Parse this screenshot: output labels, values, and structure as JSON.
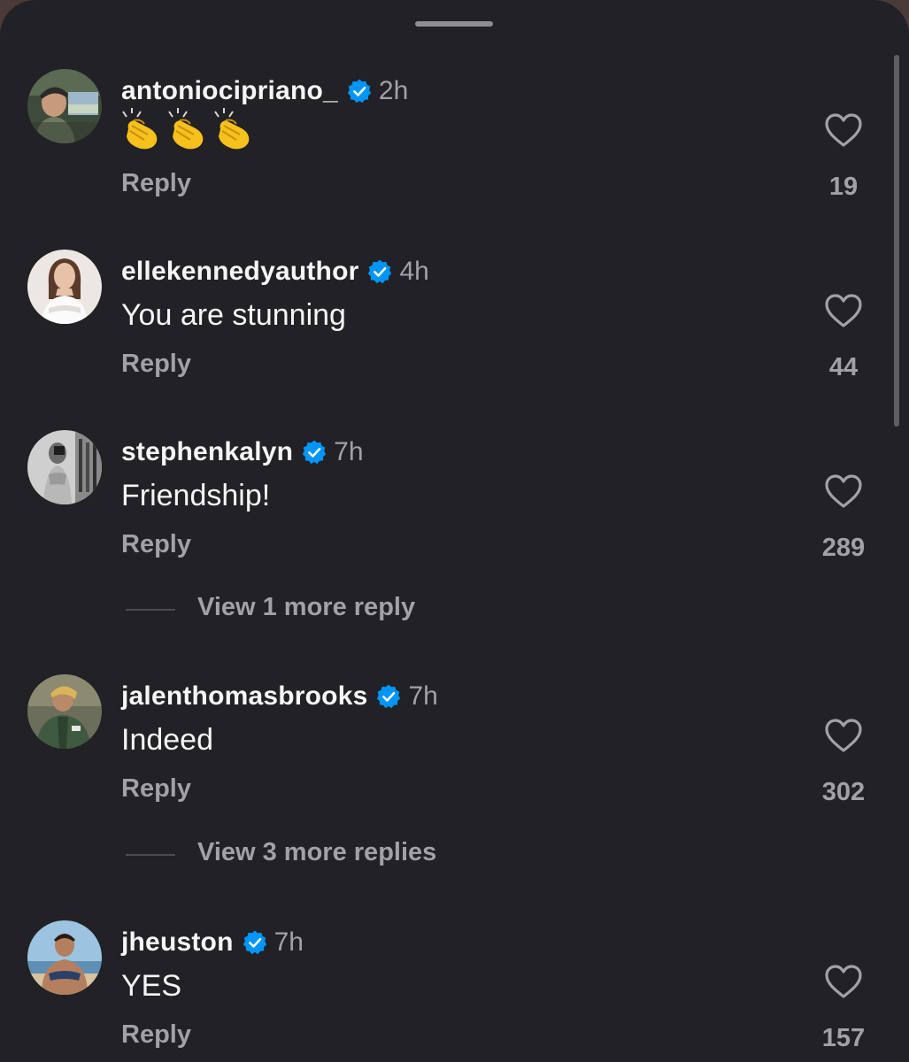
{
  "comments": [
    {
      "username": "antoniocipriano_",
      "time": "2h",
      "text": "👏👏👏",
      "reply_label": "Reply",
      "likes": "19",
      "avatar_icon": "avatar-man-in-car"
    },
    {
      "username": "ellekennedyauthor",
      "time": "4h",
      "text": "You are stunning",
      "reply_label": "Reply",
      "likes": "44",
      "avatar_icon": "avatar-woman-white-top"
    },
    {
      "username": "stephenkalyn",
      "time": "7h",
      "text": "Friendship!",
      "reply_label": "Reply",
      "likes": "289",
      "avatar_icon": "avatar-mirror-selfie-bw"
    },
    {
      "username": "jalenthomasbrooks",
      "time": "7h",
      "text": "Indeed",
      "reply_label": "Reply",
      "likes": "302",
      "avatar_icon": "avatar-man-green-jacket"
    },
    {
      "username": "jheuston",
      "time": "7h",
      "text": "YES",
      "reply_label": "Reply",
      "likes": "157",
      "avatar_icon": "avatar-man-beach"
    }
  ],
  "view_more": [
    {
      "label": "View 1 more reply"
    },
    {
      "label": "View 3 more replies"
    }
  ],
  "colors": {
    "background": "#212126",
    "primary_text": "#f5f5f7",
    "secondary_text": "#a1a1a6",
    "verified_badge": "#0095f6"
  },
  "icons": {
    "verified": "verified-badge-icon",
    "like": "heart-outline-icon",
    "grabber": "sheet-grabber-handle"
  }
}
